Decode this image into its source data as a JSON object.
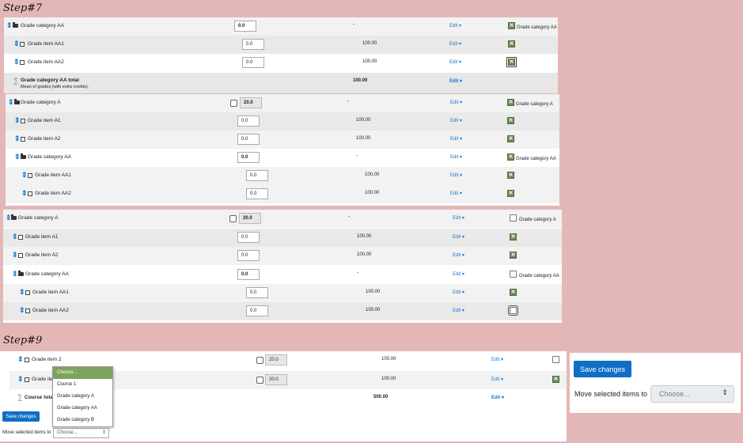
{
  "steps": {
    "step7": "Step#7",
    "step9": "Step#9"
  },
  "colors": {
    "background": "#e4b7b7",
    "link": "#1177d1",
    "primary_button": "#0f6fc5",
    "checked_box": "#6e8a5c",
    "dropdown_selected": "#7da35c"
  },
  "panel1": {
    "rows": [
      {
        "name": "Grade category AA",
        "weight": "0.0",
        "max": "-",
        "edit": "Edit",
        "cat_label": "Grade category AA"
      },
      {
        "name": "Grade item AA1",
        "weight": "0.0",
        "max": "100.00",
        "edit": "Edit"
      },
      {
        "name": "Grade item AA2",
        "weight": "0.0",
        "max": "100.00",
        "edit": "Edit"
      },
      {
        "name": "Grade category AA total",
        "sub": "Mean of grades (with extra credits).",
        "max": "100.00",
        "edit": "Edit"
      }
    ]
  },
  "panel2": {
    "rows": [
      {
        "name": "Grade category A",
        "weight": "20.0",
        "max": "-",
        "edit": "Edit",
        "cat_label": "Grade category A"
      },
      {
        "name": "Grade item A1",
        "weight": "0.0",
        "max": "100.00",
        "edit": "Edit"
      },
      {
        "name": "Grade item A2",
        "weight": "0.0",
        "max": "100.00",
        "edit": "Edit"
      },
      {
        "name": "Grade category AA",
        "weight": "0.0",
        "max": "-",
        "edit": "Edit",
        "cat_label": "Grade category AA"
      },
      {
        "name": "Grade item AA1",
        "weight": "0.0",
        "max": "100.00",
        "edit": "Edit"
      },
      {
        "name": "Grade item AA2",
        "weight": "0.0",
        "max": "100.00",
        "edit": "Edit"
      }
    ]
  },
  "panel3": {
    "rows": [
      {
        "name": "Grade category A",
        "weight": "20.0",
        "max": "-",
        "edit": "Edit",
        "cat_label": "Grade category A"
      },
      {
        "name": "Grade item A1",
        "weight": "0.0",
        "max": "100.00",
        "edit": "Edit"
      },
      {
        "name": "Grade item A2",
        "weight": "0.0",
        "max": "100.00",
        "edit": "Edit"
      },
      {
        "name": "Grade category AA",
        "weight": "0.0",
        "max": "-",
        "edit": "Edit",
        "cat_label": "Grade category AA"
      },
      {
        "name": "Grade item AA1",
        "weight": "0.0",
        "max": "100.00",
        "edit": "Edit"
      },
      {
        "name": "Grade item AA2",
        "weight": "0.0",
        "max": "100.00",
        "edit": "Edit"
      }
    ]
  },
  "panel4": {
    "rows": [
      {
        "name": "Grade item 2",
        "weight": "20.0",
        "max": "100.00",
        "edit": "Edit"
      },
      {
        "name": "Grade ite",
        "weight": "20.0",
        "max": "100.00",
        "edit": "Edit"
      },
      {
        "name": "Course total",
        "max": "500.00",
        "edit": "Edit"
      }
    ],
    "save_label": "Save changes",
    "move_label": "Move selected items to",
    "select_value": "Choose...",
    "dropdown": [
      "Choose...",
      "Course 1",
      "Grade category A",
      "Grade category AA",
      "Grade category B"
    ]
  },
  "panel5": {
    "save_label": "Save changes",
    "move_label": "Move selected items to",
    "select_value": "Choose..."
  }
}
